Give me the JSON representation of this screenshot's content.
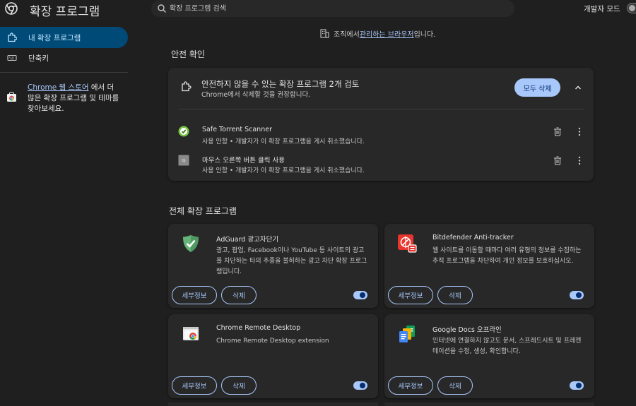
{
  "header": {
    "title": "확장 프로그램",
    "search_placeholder": "확장 프로그램 검색",
    "dev_mode_label": "개발자 모드",
    "dev_mode_on": false
  },
  "sidebar": {
    "items": [
      {
        "label": "내 확장 프로그램",
        "icon": "puzzle-icon",
        "active": true
      },
      {
        "label": "단축키",
        "icon": "keyboard-icon",
        "active": false
      }
    ],
    "store": {
      "link_text": "Chrome 웹 스토어",
      "text": "에서 더 많은 확장 프로그램 및 테마를 찾아보세요.",
      "icon": "chrome-web-store-icon"
    }
  },
  "managed_banner": {
    "prefix": "조직에서 ",
    "link": "관리하는 브라우저",
    "suffix": "입니다.",
    "icon": "building-icon"
  },
  "safety_check": {
    "section_title": "안전 확인",
    "title": "안전하지 않을 수 있는 확장 프로그램 2개 검토",
    "subtitle": "Chrome에서 삭제할 것을 권장합니다.",
    "remove_all_label": "모두 삭제",
    "items": [
      {
        "name": "Safe Torrent Scanner",
        "status": "사용 안함 • 개발자가 이 확장 프로그램을 게시 취소했습니다.",
        "icon": "safe-torrent-scanner-icon"
      },
      {
        "name": "마우스 오른쪽 버튼 클릭 사용",
        "status": "사용 안함 • 개발자가 이 확장 프로그램을 게시 취소했습니다.",
        "icon": "right-click-extension-icon"
      }
    ]
  },
  "all_extensions": {
    "section_title": "전체 확장 프로그램",
    "details_label": "세부정보",
    "remove_label": "삭제",
    "items": [
      {
        "name": "AdGuard 광고차단기",
        "description": "광고, 팝업, Facebook이나 YouTube 등 사이트의 광고를 차단하는 타의 추종을 불허하는 광고 차단 확장 프로그램입니다.",
        "enabled": true,
        "icon": "adguard-shield-icon"
      },
      {
        "name": "Bitdefender Anti-tracker",
        "description": "웹 사이트를 이동할 때마다 여러 유형의 정보를 수집하는 추적 프로그램을 차단하여 개인 정보를 보호하십시오.",
        "enabled": true,
        "icon": "bitdefender-icon"
      },
      {
        "name": "Chrome Remote Desktop",
        "description": "Chrome Remote Desktop extension",
        "enabled": true,
        "icon": "remote-desktop-icon"
      },
      {
        "name": "Google Docs 오프라인",
        "description": "인터넷에 연결하지 않고도 문서, 스프레드시트 및 프레젠테이션을 수정, 생성, 확인합니다.",
        "enabled": true,
        "icon": "google-docs-icon"
      }
    ]
  },
  "colors": {
    "background": "#1f1f1f",
    "card": "#282828",
    "accent": "#a8c7fa",
    "active_nav": "#004a77"
  }
}
